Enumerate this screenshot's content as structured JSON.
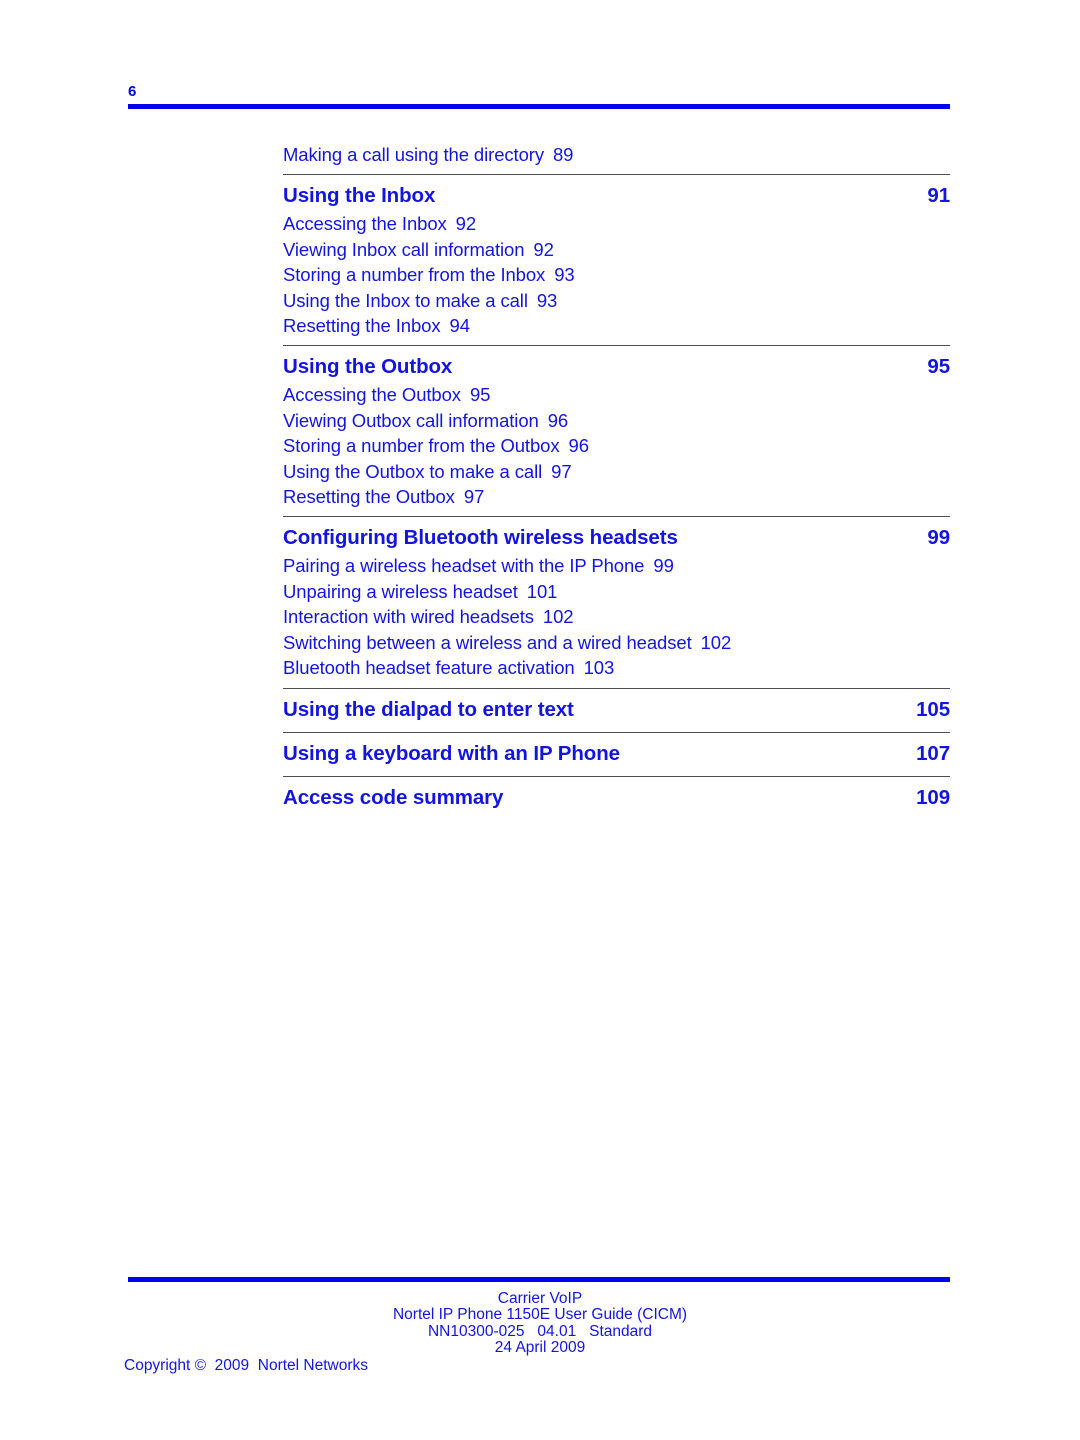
{
  "header": {
    "folio": "6"
  },
  "colors": {
    "accent_blue": "#0000f0",
    "text_blue": "#1414e0",
    "rule_gray": "#4d4d4d"
  },
  "toc": {
    "leading_entry": {
      "label": "Making a call using the directory",
      "page": "89"
    },
    "groups": [
      {
        "heading": {
          "label": "Using the Inbox",
          "page": "91"
        },
        "entries": [
          {
            "label": "Accessing the Inbox",
            "page": "92"
          },
          {
            "label": "Viewing Inbox call information",
            "page": "92"
          },
          {
            "label": "Storing a number from the Inbox",
            "page": "93"
          },
          {
            "label": "Using the Inbox to make a call",
            "page": "93"
          },
          {
            "label": "Resetting the Inbox",
            "page": "94"
          }
        ]
      },
      {
        "heading": {
          "label": "Using the Outbox",
          "page": "95"
        },
        "entries": [
          {
            "label": "Accessing the Outbox",
            "page": "95"
          },
          {
            "label": "Viewing Outbox call information",
            "page": "96"
          },
          {
            "label": "Storing a number from the Outbox",
            "page": "96"
          },
          {
            "label": "Using the Outbox to make a call",
            "page": "97"
          },
          {
            "label": "Resetting the Outbox",
            "page": "97"
          }
        ]
      },
      {
        "heading": {
          "label": "Configuring Bluetooth wireless headsets",
          "page": "99"
        },
        "entries": [
          {
            "label": "Pairing a wireless headset with the IP Phone",
            "page": "99"
          },
          {
            "label": "Unpairing a wireless headset",
            "page": "101"
          },
          {
            "label": "Interaction with wired headsets",
            "page": "102"
          },
          {
            "label": "Switching between a wireless and a wired headset",
            "page": "102"
          },
          {
            "label": "Bluetooth headset feature activation",
            "page": "103"
          }
        ]
      },
      {
        "heading": {
          "label": "Using the dialpad to enter text",
          "page": "105"
        },
        "entries": []
      },
      {
        "heading": {
          "label": "Using a keyboard with an IP Phone",
          "page": "107"
        },
        "entries": []
      },
      {
        "heading": {
          "label": "Access code summary",
          "page": "109"
        },
        "entries": []
      }
    ]
  },
  "footer": {
    "line1": "Carrier VoIP",
    "line2": "Nortel IP Phone 1150E User Guide (CICM)",
    "line3": "NN10300-025   04.01   Standard",
    "line4": "24 April 2009",
    "copyright": "Copyright ©  2009  Nortel Networks"
  }
}
